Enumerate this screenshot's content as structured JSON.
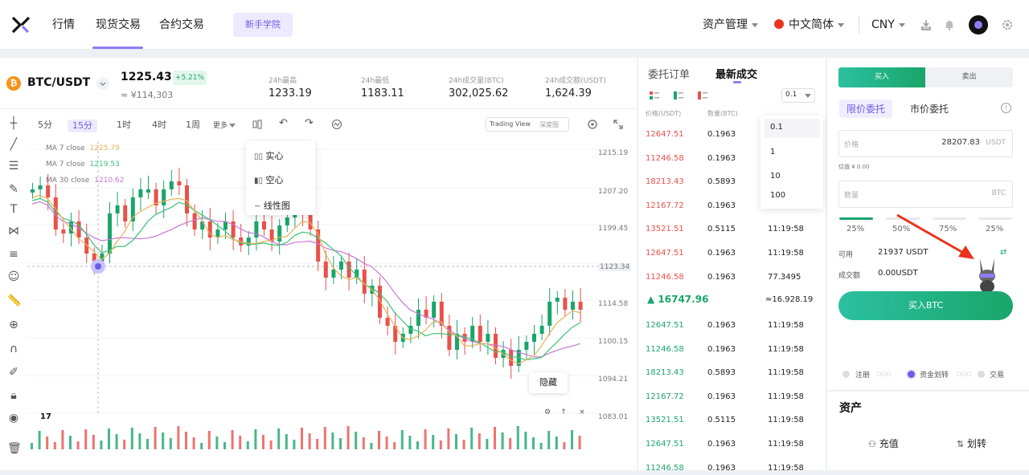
{
  "nav": {
    "items": [
      "行情",
      "现货交易",
      "合约交易"
    ],
    "newbie": "新手学院",
    "asset_mgmt": "资产管理",
    "language": "中文简体",
    "currency": "CNY"
  },
  "ticker": {
    "pair": "BTC/USDT",
    "coin_symbol": "₿",
    "price": "1225.43",
    "change": "+5.21%",
    "price_cny": "≈ ¥114,303",
    "stats": [
      {
        "label": "24h最高",
        "value": "1233.19"
      },
      {
        "label": "24h最低",
        "value": "1183.11"
      },
      {
        "label": "24h成交量(BTC)",
        "value": "302,025.62"
      },
      {
        "label": "24h成交额(USDT)",
        "value": "1,624.39"
      }
    ]
  },
  "chart_toolbar": {
    "timeframes": [
      "5分",
      "15分",
      "1时",
      "4时",
      "1周"
    ],
    "active_timeframe": "15分",
    "more": "更多",
    "view_tradingview": "Trading View",
    "view_depth": "深度图"
  },
  "chart_menu": [
    "实心",
    "空心",
    "线性图"
  ],
  "chart_hide": "隐藏",
  "chart_data": {
    "type": "candlestick",
    "ma_legend": [
      {
        "label": "MA 7 close",
        "value": "1225.79",
        "color": "#e6b45a"
      },
      {
        "label": "MA 7 close",
        "value": "1219.53",
        "color": "#3bc27a"
      },
      {
        "label": "MA 30 close",
        "value": "1210.62",
        "color": "#c778d8"
      }
    ],
    "y_ticks": [
      "1215.19",
      "1207.20",
      "1199.45",
      "1123.34",
      "1114.58",
      "1100.15",
      "1094.21",
      "1083.01"
    ],
    "up_color": "#1aa56a",
    "down_color": "#e8514b"
  },
  "orderbook": {
    "tab_orders": "委托订单",
    "tab_trades": "最新成交",
    "depth_value": "0.1",
    "depth_options": [
      "0.1",
      "1",
      "10",
      "100"
    ],
    "col_price": "价格(USDT)",
    "col_amount": "数量(BTC)",
    "asks": [
      {
        "price": "12647.51",
        "amount": "0.1963",
        "time": ""
      },
      {
        "price": "11246.58",
        "amount": "0.1963",
        "time": ""
      },
      {
        "price": "18213.43",
        "amount": "0.5893",
        "time": ""
      },
      {
        "price": "12167.72",
        "amount": "0.1963",
        "time": ""
      },
      {
        "price": "13521.51",
        "amount": "0.5115",
        "time": "11:19:58"
      },
      {
        "price": "12647.51",
        "amount": "0.1963",
        "time": "11:19:58"
      },
      {
        "price": "11246.58",
        "amount": "0.1963",
        "time": "77.3495"
      }
    ],
    "last_price": "16747.96",
    "last_cny": "≈16.928.19",
    "bids": [
      {
        "price": "12647.51",
        "amount": "0.1963",
        "time": "11:19:58"
      },
      {
        "price": "11246.58",
        "amount": "0.1963",
        "time": "11:19:58"
      },
      {
        "price": "18213.43",
        "amount": "0.5893",
        "time": "11:19:58"
      },
      {
        "price": "12167.72",
        "amount": "0.1963",
        "time": "11:19:58"
      },
      {
        "price": "13521.51",
        "amount": "0.5115",
        "time": "11:19:58"
      },
      {
        "price": "12647.51",
        "amount": "0.1963",
        "time": "11:19:58"
      },
      {
        "price": "11246.58",
        "amount": "0.1963",
        "time": "11:19:58"
      }
    ]
  },
  "trade": {
    "buy_tab": "买入",
    "sell_tab": "卖出",
    "limit": "限价委托",
    "market": "市价委托",
    "price_ph": "价格",
    "price_val": "28207.83",
    "price_unit": "USDT",
    "estimate": "估值 ¥ 0.00",
    "amount_ph": "数量",
    "amount_unit": "BTC",
    "percents": [
      "25%",
      "50%",
      "75%",
      "25%"
    ],
    "available_label": "可用",
    "available_value": "21937 USDT",
    "filled_label": "成交额",
    "filled_value": "0.00USDT",
    "buy_button": "买入BTC",
    "steps": [
      "注册",
      "资金划转",
      "交易"
    ]
  },
  "assets": {
    "title": "资产",
    "deposit": "充值",
    "transfer": "划转"
  }
}
